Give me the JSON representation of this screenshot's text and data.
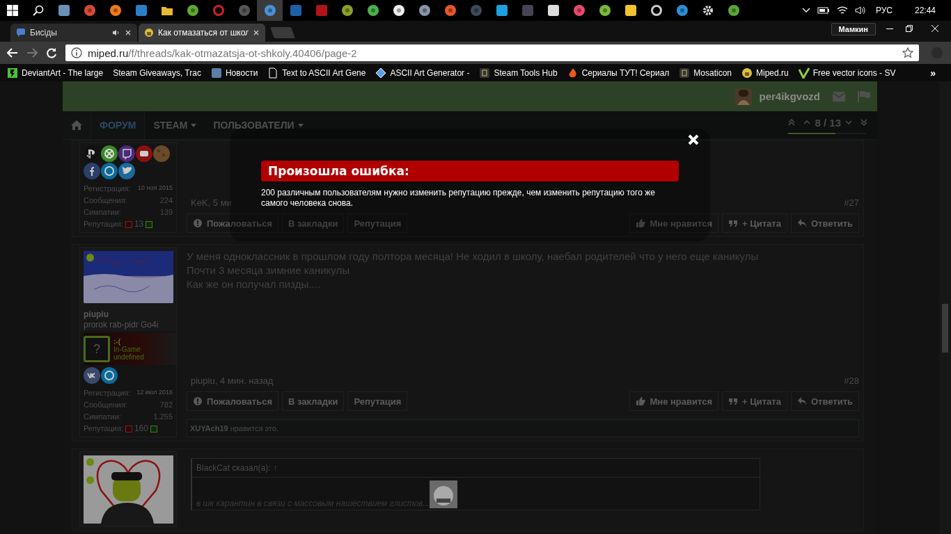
{
  "taskbar": {
    "apps": [
      {
        "active": false
      },
      {
        "active": false
      },
      {
        "active": false
      },
      {
        "active": false
      },
      {
        "active": false
      },
      {
        "active": false
      },
      {
        "active": false
      },
      {
        "active": false
      },
      {
        "active": true
      },
      {
        "active": false
      },
      {
        "active": false
      },
      {
        "active": false
      },
      {
        "active": false
      },
      {
        "active": false
      },
      {
        "active": false
      },
      {
        "active": false
      },
      {
        "active": false
      },
      {
        "active": false
      },
      {
        "active": false
      },
      {
        "active": false
      },
      {
        "active": false
      },
      {
        "active": false
      },
      {
        "active": false
      },
      {
        "active": false
      },
      {
        "active": false
      },
      {
        "active": false
      },
      {
        "active": false
      }
    ],
    "language": "РУС",
    "time": "22:44"
  },
  "browser": {
    "tabs": [
      {
        "title": "Бисіды",
        "selected": false,
        "audio": true
      },
      {
        "title": "Как отмазаться от школ",
        "selected": true,
        "audio": false
      }
    ],
    "profile": "Мамкин",
    "forward_disabled": true,
    "address": {
      "domain": "miped.ru",
      "path": "/f/threads/kak-otmazatsja-ot-shkoly.40406/page-2"
    },
    "bookmarks": [
      {
        "title": "DeviantArt - The large"
      },
      {
        "title": "Steam Giveaways, Trac"
      },
      {
        "title": "Новости"
      },
      {
        "title": "Text to ASCII Art Gene"
      },
      {
        "title": "ASCII Art Generator -"
      },
      {
        "title": "Steam Tools Hub"
      },
      {
        "title": "Сериалы ТУТ! Сериал"
      },
      {
        "title": "Mosaticon"
      },
      {
        "title": "Miped.ru"
      },
      {
        "title": "Free vector icons - SV"
      }
    ],
    "bookmarks_more": "»"
  },
  "forum": {
    "user": "per4ikgvozd",
    "nav": [
      {
        "kind": "home",
        "selected": false
      },
      {
        "kind": "link",
        "label": "ФОРУМ",
        "selected": true
      },
      {
        "kind": "menu",
        "label": "STEAM",
        "selected": false
      },
      {
        "kind": "menu",
        "label": "ПОЛЬЗОВАТЕЛИ",
        "selected": false
      }
    ],
    "pager": {
      "text": "8 / 13",
      "level": 0.6
    }
  },
  "posts": [
    {
      "social": [
        {
          "kind": "ps"
        },
        {
          "kind": "xbox"
        },
        {
          "kind": "twitch"
        },
        {
          "kind": "youtube"
        },
        {
          "kind": "dirt"
        },
        {
          "kind": "facebook"
        },
        {
          "kind": "skype"
        },
        {
          "kind": "twitter"
        }
      ],
      "stats": [
        {
          "label": "Регистрация:",
          "value": "10 ноя 2015"
        },
        {
          "label": "Сообщения:",
          "value": "224"
        },
        {
          "label": "Симпатии:",
          "value": "139"
        }
      ],
      "reputation_label": "Репутация:",
      "reputation": "13",
      "meta": "KeK, 5 ми",
      "number": "#27",
      "actions": [
        {
          "label": "Пожаловаться",
          "kind": "report"
        },
        {
          "label": "В закладки",
          "kind": "plain"
        },
        {
          "label": "Репутация",
          "kind": "plain"
        },
        {
          "label": "Мне нравится",
          "kind": "like"
        },
        {
          "label": "+ Цитата",
          "kind": "quote"
        },
        {
          "label": "Ответить",
          "kind": "reply"
        }
      ]
    },
    {
      "avatar": {
        "kind": "picture"
      },
      "indicators": [
        {
          "on": true
        }
      ],
      "username": "piupiu",
      "user_title": "prorok rab-pidr Go4i",
      "steam": {
        "avatar": "?",
        "mood": ":-(",
        "line1": "In-Game",
        "line2": "undefined"
      },
      "social": [
        {
          "kind": "vk"
        },
        {
          "kind": "skype"
        }
      ],
      "stats": [
        {
          "label": "Регистрация:",
          "value": "12 июл 2016"
        },
        {
          "label": "Сообщения:",
          "value": "782"
        },
        {
          "label": "Симпатии:",
          "value": "1.255"
        }
      ],
      "reputation_label": "Репутация:",
      "reputation": "160",
      "body": [
        "У меня одноклассник в прошлом году полтора месяца! Не ходил в школу, наебал родителей что у него еще каникулы",
        "Почти 3 месяца зимние каникулы",
        "Как же он получал пизды...."
      ],
      "meta": "piupiu, 4 мин. назад",
      "number": "#28",
      "actions": [
        {
          "label": "Пожаловаться",
          "kind": "report"
        },
        {
          "label": "В закладки",
          "kind": "plain"
        },
        {
          "label": "Репутация",
          "kind": "plain"
        },
        {
          "label": "Мне нравится",
          "kind": "like"
        },
        {
          "label": "+ Цитата",
          "kind": "quote"
        },
        {
          "label": "Ответить",
          "kind": "reply"
        }
      ],
      "likes": "**XUYAch19** нравится это."
    },
    {
      "avatar": {
        "kind": "picture"
      },
      "indicators": [
        {
          "on": true
        },
        {
          "on": true
        }
      ],
      "quote": {
        "author": "BlackCat сказал(а):",
        "arrow": "↑",
        "text": "в шк карантин в связи с массовым нашествием глистов..."
      }
    }
  ],
  "modal": {
    "title": "Произошла ошибка:",
    "message": "200 различным пользователям нужно изменить репутацию прежде, чем изменить репутацию того же самого человека снова."
  }
}
